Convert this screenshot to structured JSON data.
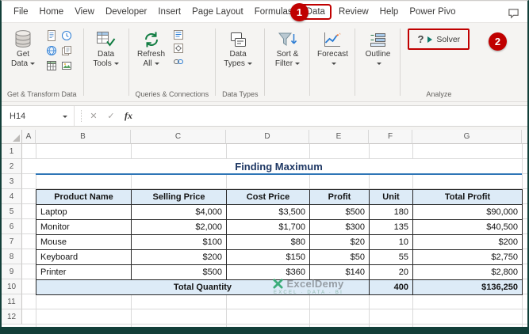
{
  "tabs": [
    "File",
    "Home",
    "View",
    "Developer",
    "Insert",
    "Page Layout",
    "Formulas",
    "Data",
    "Review",
    "Help",
    "Power Pivo"
  ],
  "ribbon": {
    "get_data": {
      "line1": "Get",
      "line2": "Data"
    },
    "data_tools": {
      "line1": "Data",
      "line2": "Tools"
    },
    "refresh_all": {
      "line1": "Refresh",
      "line2": "All"
    },
    "data_types_btn": {
      "line1": "Data",
      "line2": "Types"
    },
    "sort_filter": {
      "line1": "Sort &",
      "line2": "Filter"
    },
    "forecast": {
      "line1": "Forecast"
    },
    "outline": {
      "line1": "Outline"
    },
    "solver": "Solver",
    "labels": {
      "get_transform": "Get & Transform Data",
      "queries": "Queries & Connections",
      "data_types": "Data Types",
      "analyze": "Analyze"
    }
  },
  "formula_bar": {
    "name_box": "H14",
    "cancel_glyph": "✕",
    "enter_glyph": "✓",
    "fx_glyph": "fx",
    "value": ""
  },
  "icons": {
    "solver_question": "?"
  },
  "sheet": {
    "columns": [
      "A",
      "B",
      "C",
      "D",
      "E",
      "F",
      "G"
    ],
    "rows": [
      "1",
      "2",
      "3",
      "4",
      "5",
      "6",
      "7",
      "8",
      "9",
      "10",
      "11",
      "12"
    ],
    "title": "Finding Maximum",
    "table": {
      "headers": [
        "Product Name",
        "Selling Price",
        "Cost Price",
        "Profit",
        "Unit",
        "Total Profit"
      ],
      "rows": [
        [
          "Laptop",
          "$4,000",
          "$3,500",
          "$500",
          "180",
          "$90,000"
        ],
        [
          "Monitor",
          "$2,000",
          "$1,700",
          "$300",
          "135",
          "$40,500"
        ],
        [
          "Mouse",
          "$100",
          "$80",
          "$20",
          "10",
          "$200"
        ],
        [
          "Keyboard",
          "$200",
          "$150",
          "$50",
          "55",
          "$2,750"
        ],
        [
          "Printer",
          "$500",
          "$360",
          "$140",
          "20",
          "$2,800"
        ]
      ],
      "total_label": "Total Quantity",
      "total_unit": "400",
      "total_profit": "$136,250"
    }
  },
  "watermark": {
    "brand": "ExcelDemy",
    "tagline": "EXCEL · DATA · BI"
  },
  "annotations": {
    "step1": "1",
    "step2": "2"
  },
  "colors": {
    "annotation_red": "#C00000",
    "table_header_fill": "#DDEBF7",
    "title_text": "#1F3864",
    "title_underline": "#2E75B6",
    "excel_green": "#107C41"
  }
}
